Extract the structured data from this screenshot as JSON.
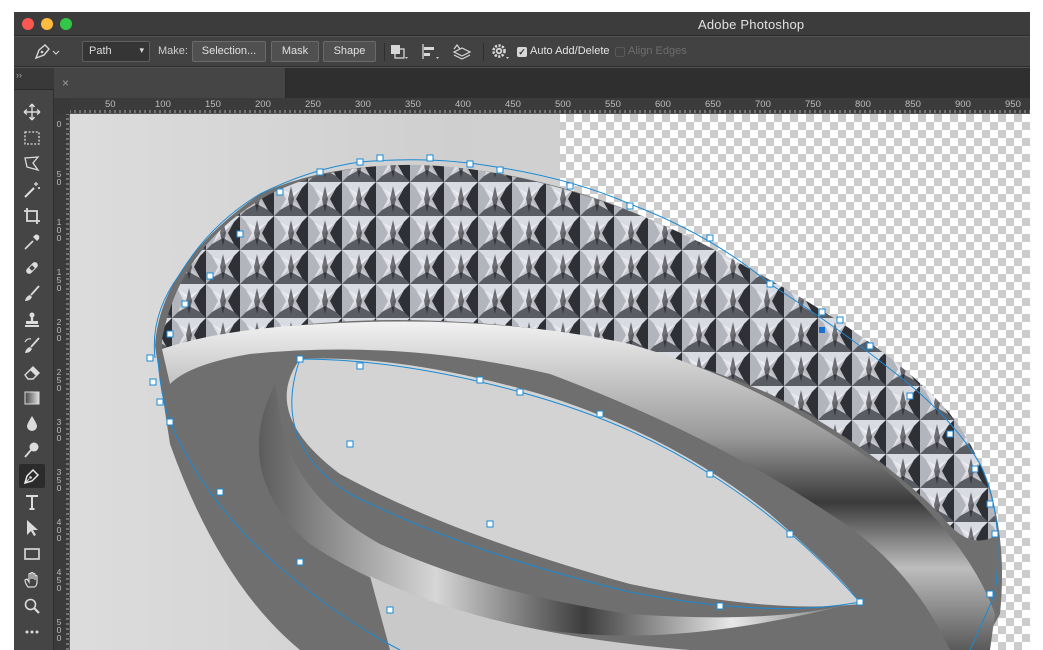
{
  "app": {
    "title": "Adobe Photoshop"
  },
  "options": {
    "mode_value": "Path",
    "make_label": "Make:",
    "selection_label": "Selection...",
    "mask_label": "Mask",
    "shape_label": "Shape",
    "auto_add_delete_label": "Auto Add/Delete",
    "auto_add_delete_checked": true,
    "align_edges_label": "Align Edges",
    "align_edges_checked": false
  },
  "document_tab": {
    "close_glyph": "×"
  },
  "ruler": {
    "horizontal": [
      "50",
      "100",
      "150",
      "200",
      "250",
      "300",
      "350",
      "400",
      "450",
      "500",
      "550",
      "600",
      "650",
      "700",
      "750",
      "800",
      "850",
      "900",
      "950"
    ],
    "vertical": [
      "0",
      "5 0",
      "1 0 0",
      "1 5 0",
      "2 0 0",
      "2 5 0",
      "3 0 0",
      "3 5 0",
      "4 0 0",
      "4 5 0",
      "5 0 0"
    ]
  },
  "tools": [
    {
      "name": "move",
      "icon": "move-icon"
    },
    {
      "name": "marquee",
      "icon": "rectangular-marquee-icon"
    },
    {
      "name": "lasso",
      "icon": "polygonal-lasso-icon"
    },
    {
      "name": "magic-wand",
      "icon": "magic-wand-icon"
    },
    {
      "name": "crop",
      "icon": "crop-icon"
    },
    {
      "name": "eyedropper",
      "icon": "eyedropper-icon"
    },
    {
      "name": "healing",
      "icon": "bandage-icon"
    },
    {
      "name": "brush",
      "icon": "brush-icon"
    },
    {
      "name": "stamp",
      "icon": "clone-stamp-icon"
    },
    {
      "name": "history-brush",
      "icon": "history-brush-icon"
    },
    {
      "name": "eraser",
      "icon": "eraser-icon"
    },
    {
      "name": "gradient",
      "icon": "gradient-icon"
    },
    {
      "name": "blur",
      "icon": "drop-icon"
    },
    {
      "name": "dodge",
      "icon": "dodge-icon"
    },
    {
      "name": "pen",
      "icon": "pen-icon",
      "active": true
    },
    {
      "name": "type",
      "icon": "type-icon",
      "glyph": "T"
    },
    {
      "name": "path-selection",
      "icon": "arrow-icon"
    },
    {
      "name": "rectangle",
      "icon": "rectangle-icon"
    },
    {
      "name": "hand",
      "icon": "hand-icon"
    },
    {
      "name": "zoom",
      "icon": "zoom-icon"
    },
    {
      "name": "more",
      "icon": "more-icon",
      "glyph": "•••"
    }
  ],
  "colors": {
    "path": "#1a8ad4",
    "anchor_selected": "#1a6fd4"
  }
}
